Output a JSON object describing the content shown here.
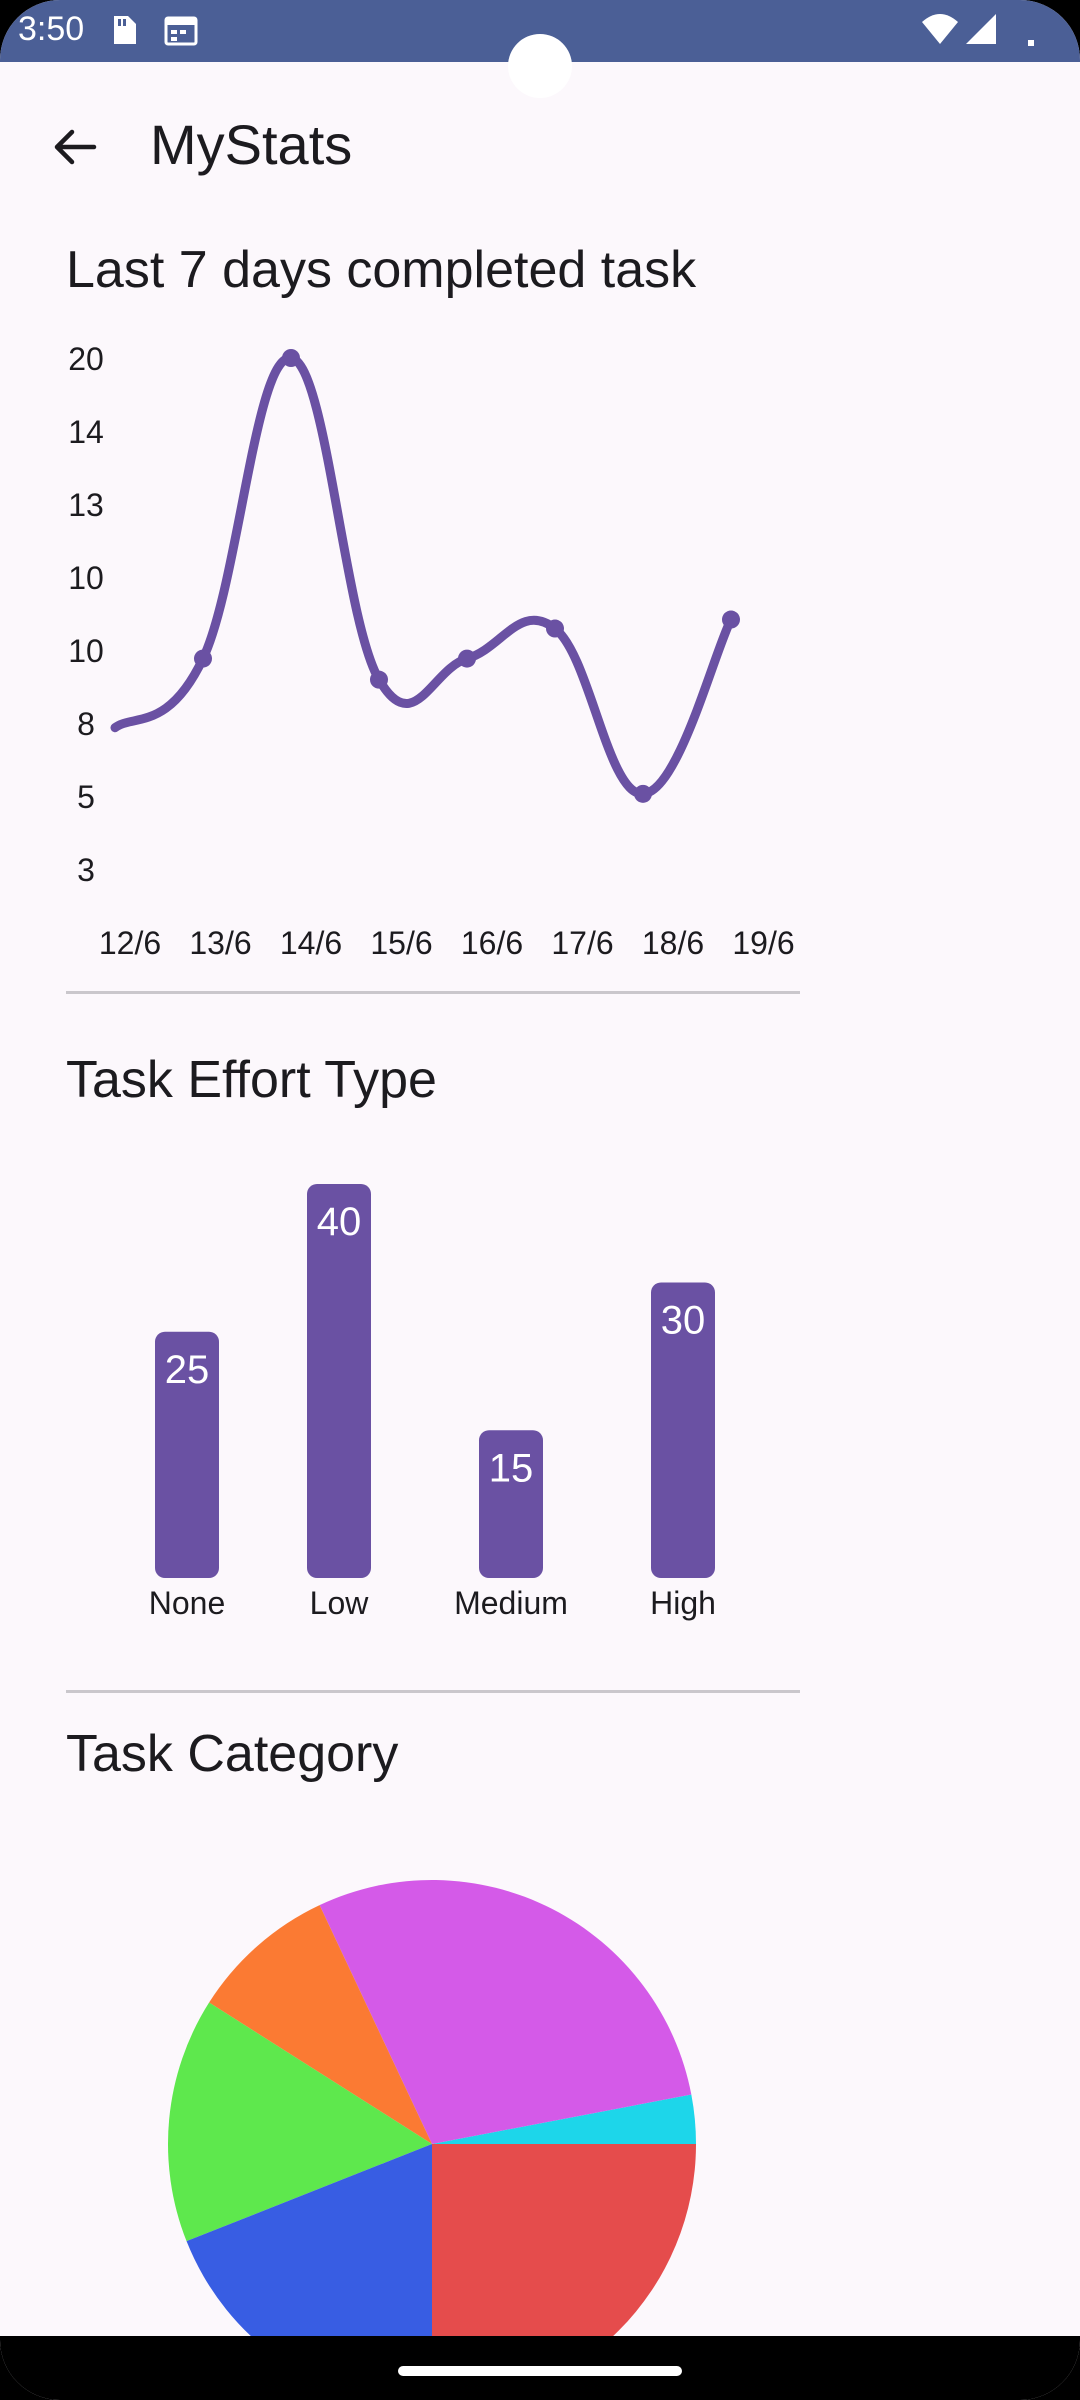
{
  "status_bar": {
    "time": "3:50",
    "icons_left": [
      "sd-card-icon",
      "calendar-icon"
    ],
    "icons_right": [
      "wifi-icon",
      "cell-signal-icon",
      "battery-dot-icon"
    ]
  },
  "header": {
    "back_icon": "arrow-left-icon",
    "title": "MyStats"
  },
  "sections": {
    "line": {
      "title": "Last 7 days completed task"
    },
    "bar": {
      "title": "Task Effort Type"
    },
    "pie": {
      "title": "Task Category"
    }
  },
  "colors": {
    "accent": "#6a51a3",
    "status_bar": "#4b5f96",
    "background": "#fcf8fc"
  },
  "chart_data": [
    {
      "type": "line",
      "title": "Last 7 days completed task",
      "y_tick_labels": [
        "20",
        "14",
        "13",
        "10",
        "10",
        "8",
        "5",
        "3"
      ],
      "categories": [
        "12/6",
        "13/6",
        "14/6",
        "15/6",
        "16/6",
        "17/6",
        "18/6",
        "19/6"
      ],
      "values": [
        7.7,
        10.0,
        20.0,
        9.3,
        10.0,
        11.0,
        5.5,
        11.3
      ],
      "ylim": [
        3,
        20
      ],
      "color": "#6a51a3"
    },
    {
      "type": "bar",
      "title": "Task Effort Type",
      "categories": [
        "None",
        "Low",
        "Medium",
        "High"
      ],
      "values": [
        25,
        40,
        15,
        30
      ],
      "data_labels": [
        "25",
        "40",
        "15",
        "30"
      ],
      "color": "#6a51a3"
    },
    {
      "type": "pie",
      "title": "Task Category",
      "slices": [
        {
          "value": 3,
          "color": "#1dd6ea"
        },
        {
          "value": 29,
          "color": "#d45ae8"
        },
        {
          "value": 9,
          "color": "#fb7a33"
        },
        {
          "value": 15,
          "color": "#5ee84d"
        },
        {
          "value": 19,
          "color": "#385de3"
        },
        {
          "value": 25,
          "color": "#e54c4c"
        }
      ]
    }
  ]
}
